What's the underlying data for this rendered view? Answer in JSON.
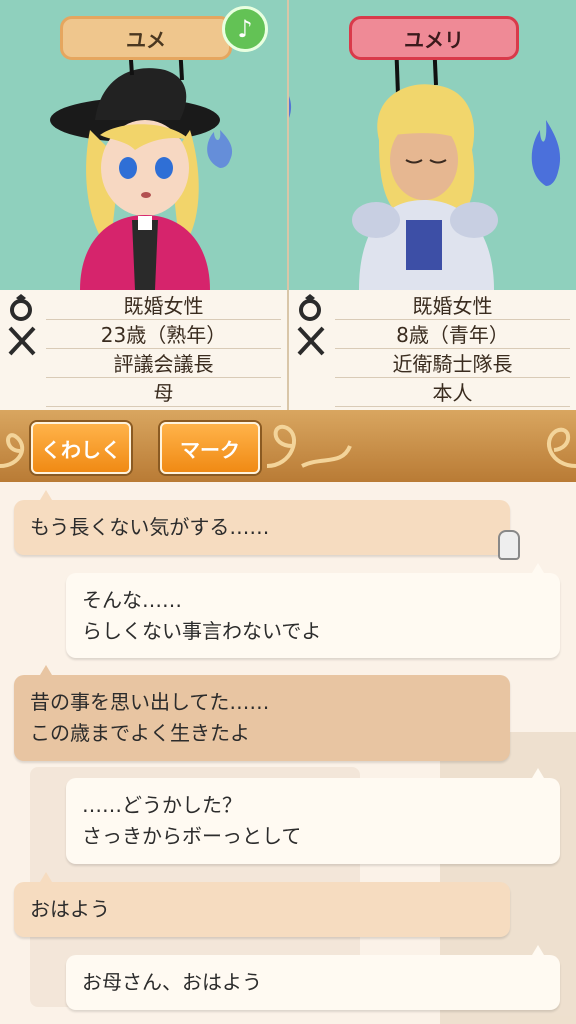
{
  "characters": {
    "left": {
      "name": "ユメ",
      "info": [
        "既婚女性",
        "23歳（熟年）",
        "評議会議長",
        "母"
      ],
      "plate_color": "#efc68d"
    },
    "right": {
      "name": "ユメリ",
      "info": [
        "既婚女性",
        "8歳（青年）",
        "近衛騎士隊長",
        "本人"
      ],
      "plate_color": "#ef8a96"
    }
  },
  "music_button": {
    "icon": "music-note-icon",
    "glyph": "♪"
  },
  "toolbar": {
    "details_label": "くわしく",
    "mark_label": "マーク"
  },
  "chat": {
    "messages": [
      {
        "side": "left",
        "lines": [
          "もう長くない気がする……"
        ]
      },
      {
        "side": "right",
        "lines": [
          "そんな……",
          "らしくない事言わないでよ"
        ]
      },
      {
        "side": "left",
        "lines": [
          "昔の事を思い出してた……",
          "この歳までよく生きたよ"
        ]
      },
      {
        "side": "right",
        "lines": [
          "……どうかした？",
          "さっきからボーっとして"
        ]
      },
      {
        "side": "left",
        "lines": [
          "おはよう"
        ]
      },
      {
        "side": "right",
        "lines": [
          "お母さん、おはよう"
        ]
      }
    ]
  },
  "colors": {
    "portrait_bg": "#8fd0bd",
    "toolbar_bg": "#c98f41",
    "button_orange": "#f08a14"
  }
}
